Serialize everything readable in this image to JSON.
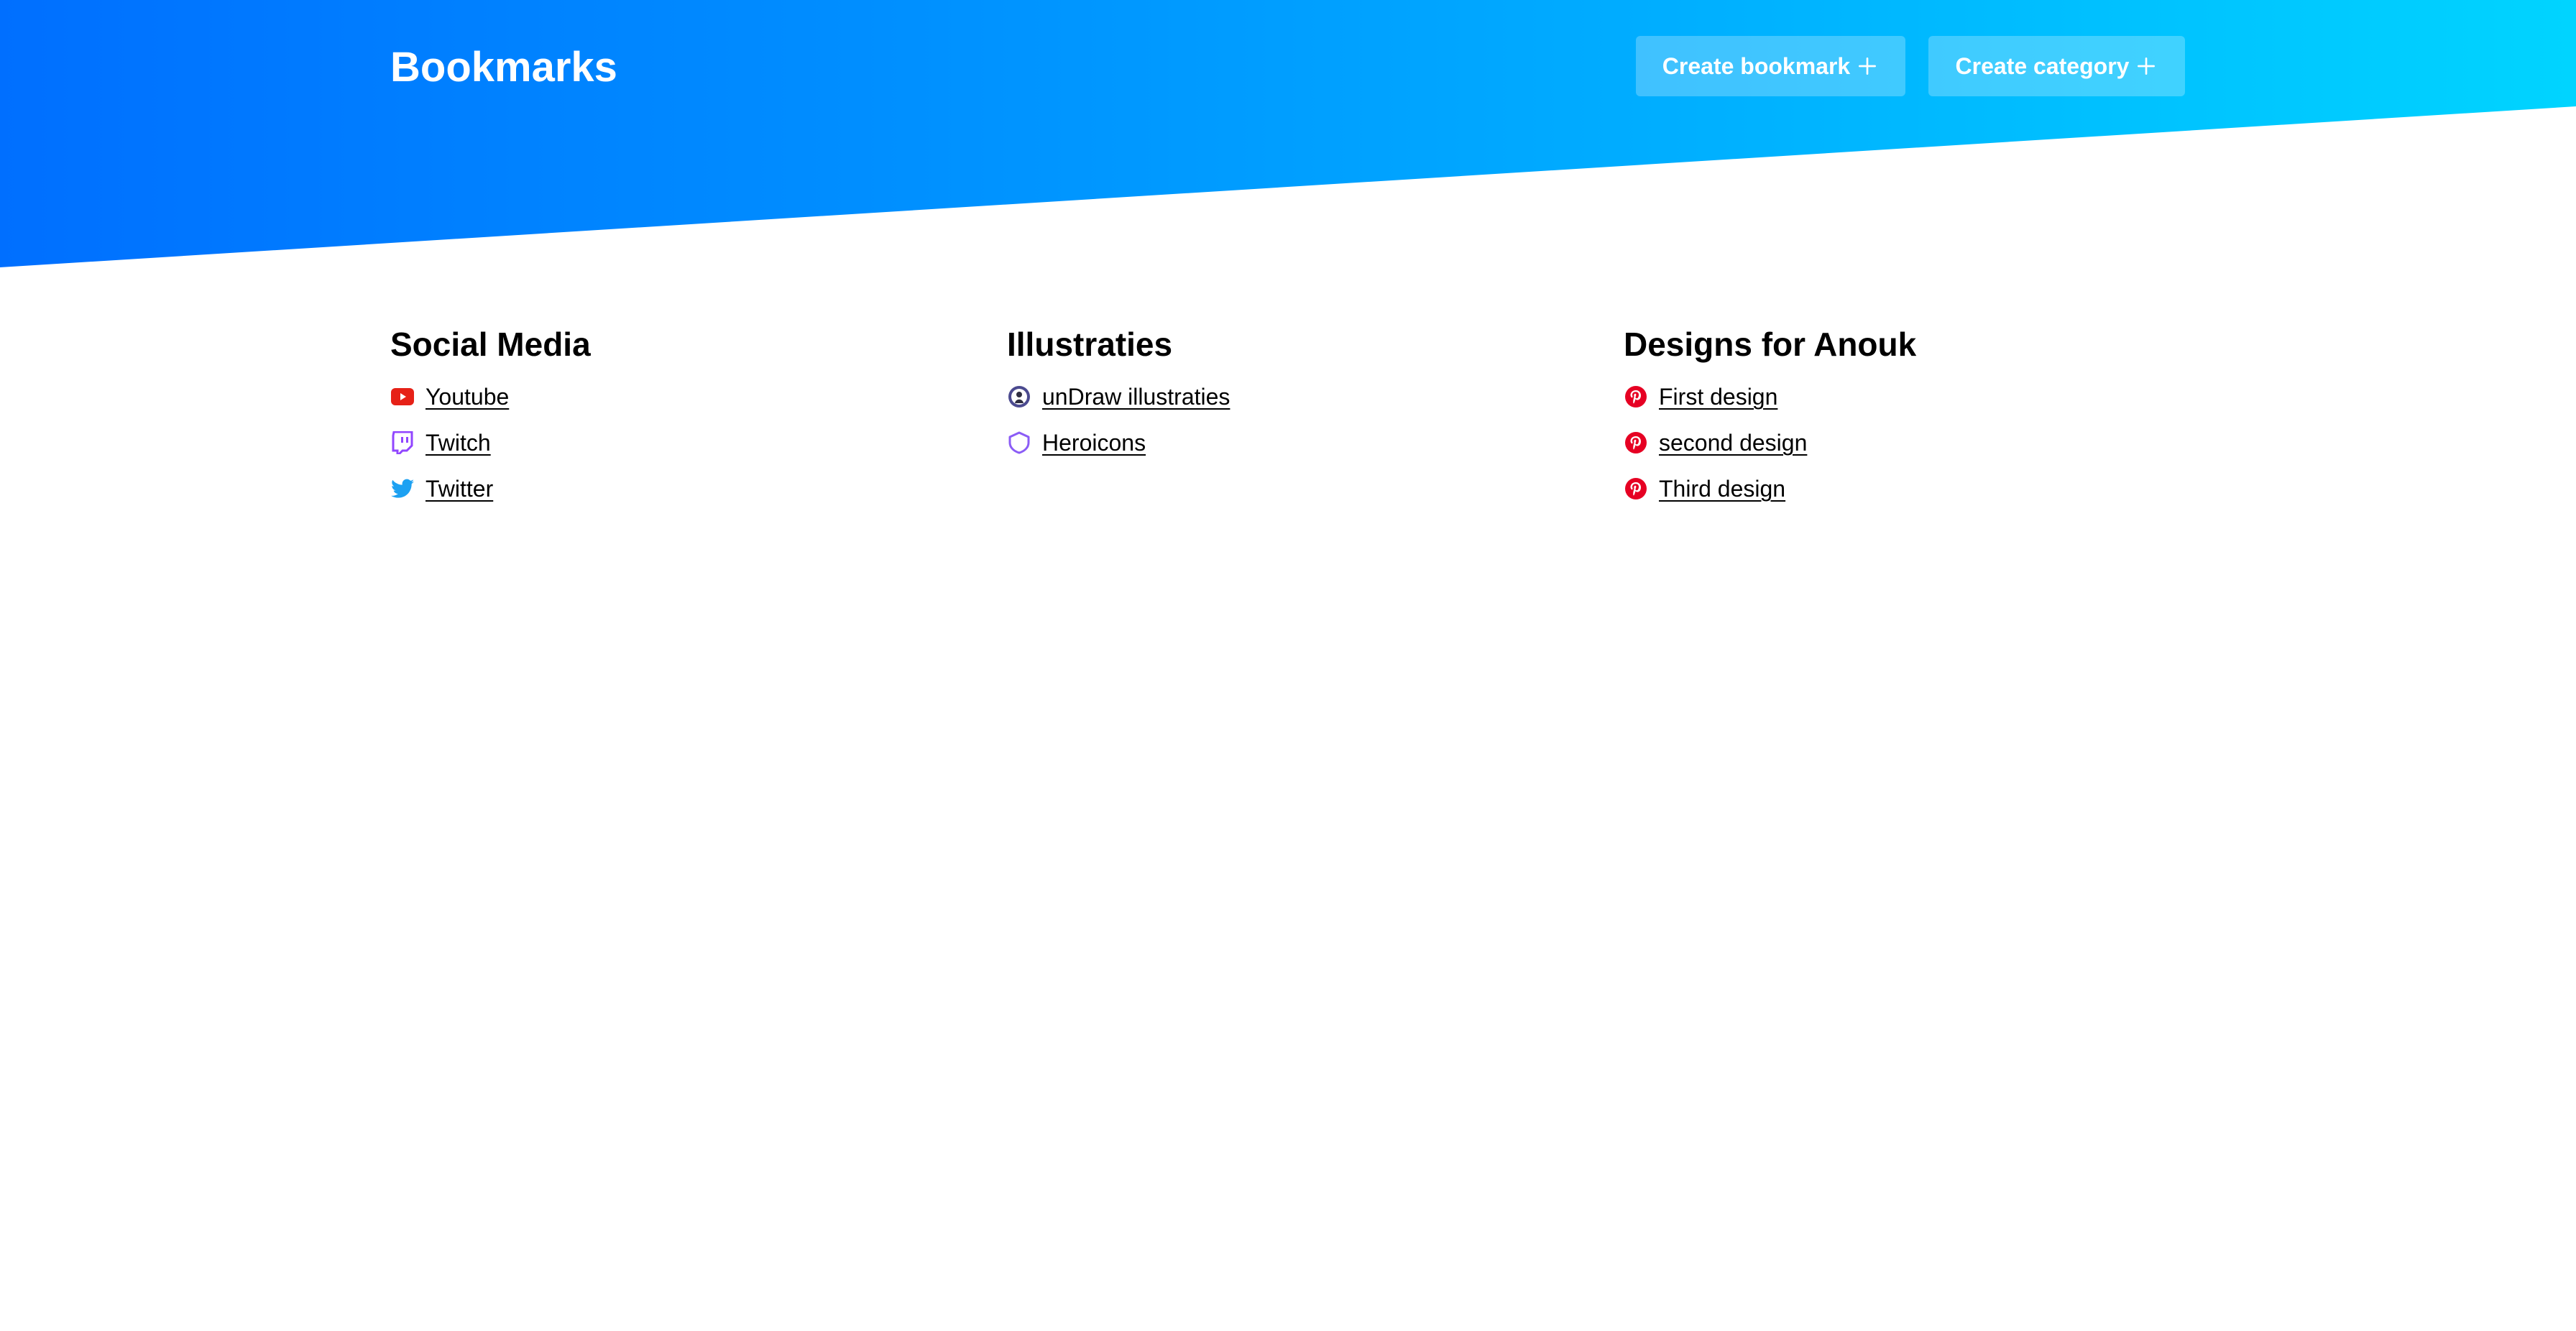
{
  "header": {
    "title": "Bookmarks",
    "create_bookmark_label": "Create bookmark",
    "create_category_label": "Create category",
    "gradient_start": "#006fff",
    "gradient_end": "#00d4ff"
  },
  "categories": [
    {
      "title": "Social Media",
      "bookmarks": [
        {
          "label": "Youtube",
          "icon": "youtube-icon",
          "color": "#e62117"
        },
        {
          "label": "Twitch",
          "icon": "twitch-icon",
          "color": "#9146ff"
        },
        {
          "label": "Twitter",
          "icon": "twitter-icon",
          "color": "#1da1f2"
        }
      ]
    },
    {
      "title": "Illustraties",
      "bookmarks": [
        {
          "label": "unDraw illustraties",
          "icon": "undraw-icon",
          "color": "#4b4a8f"
        },
        {
          "label": "Heroicons",
          "icon": "heroicons-icon",
          "color": "#8b5cf6"
        }
      ]
    },
    {
      "title": "Designs for Anouk",
      "bookmarks": [
        {
          "label": "First design",
          "icon": "pinterest-icon",
          "color": "#e60023"
        },
        {
          "label": "second design",
          "icon": "pinterest-icon",
          "color": "#e60023"
        },
        {
          "label": "Third design",
          "icon": "pinterest-icon",
          "color": "#e60023"
        }
      ]
    }
  ]
}
